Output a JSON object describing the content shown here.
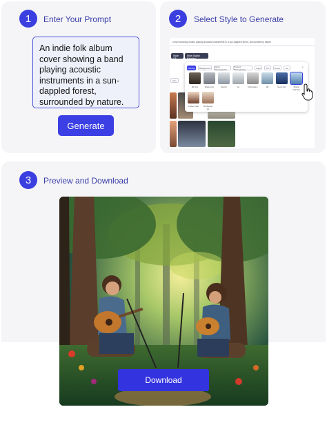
{
  "steps": [
    {
      "number": "1",
      "title": "Enter Your Prompt"
    },
    {
      "number": "2",
      "title": "Select Style to Generate"
    },
    {
      "number": "3",
      "title": "Preview and Download"
    }
  ],
  "prompt": {
    "text": "An indie folk album cover showing a band playing acoustic instruments in a sun-dappled forest, surrounded by nature."
  },
  "generate_button": {
    "label": "Generate"
  },
  "mini_ui": {
    "prompt_text": "r cover showing a band playing acoustic instruments in a sun-dappled forest, surrounded by nature",
    "chips": [
      "Style V3",
      "Style Digital Painting"
    ],
    "tabs": [
      "Painting",
      "Background",
      "Movie Photographic",
      "Product Photography",
      "Logo",
      "Pro",
      "Home",
      "Hu"
    ],
    "style_captions": [
      "Big Cat",
      "Watercolor",
      "Sketch",
      "Art",
      "Minimalism",
      "3D",
      "Neon Noir",
      "Digital Painting"
    ],
    "side_tab": "Rec",
    "popup_captions": [
      "Coffee Style",
      "3D Render Art"
    ]
  },
  "download_button": {
    "label": "Download"
  },
  "colors": {
    "accent": "#3b3fe4",
    "card_bg": "#f5f5f7",
    "title_text": "#3a3ea8"
  }
}
